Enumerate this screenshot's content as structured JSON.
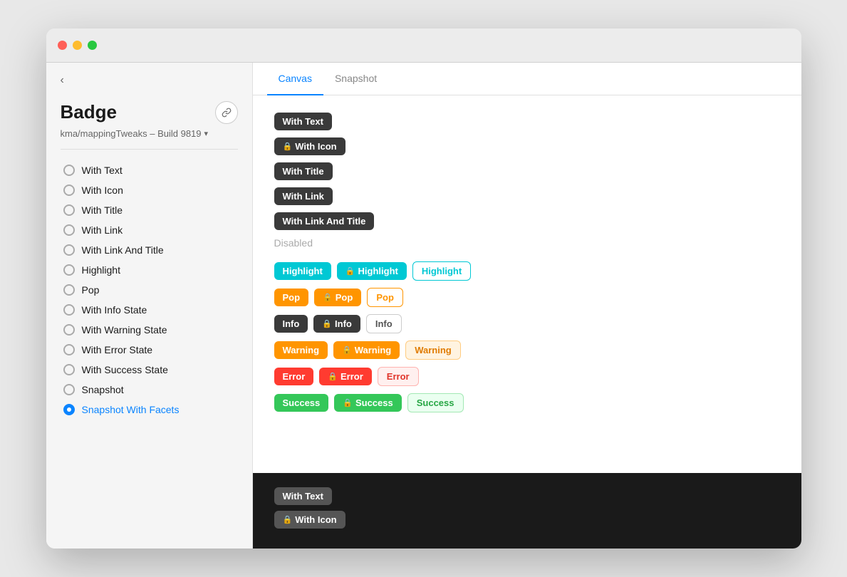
{
  "window": {
    "title": "Badge"
  },
  "titlebar": {
    "tl_red": "close",
    "tl_yellow": "minimize",
    "tl_green": "maximize"
  },
  "sidebar": {
    "back_label": "‹",
    "title": "Badge",
    "subtitle": "kma/mappingTweaks – Build 9819",
    "link_icon": "🔗",
    "nav_items": [
      {
        "id": "with-text",
        "label": "With Text",
        "active": false
      },
      {
        "id": "with-icon",
        "label": "With Icon",
        "active": false
      },
      {
        "id": "with-title",
        "label": "With Title",
        "active": false
      },
      {
        "id": "with-link",
        "label": "With Link",
        "active": false
      },
      {
        "id": "with-link-and-title",
        "label": "With Link And Title",
        "active": false
      },
      {
        "id": "highlight",
        "label": "Highlight",
        "active": false
      },
      {
        "id": "pop",
        "label": "Pop",
        "active": false
      },
      {
        "id": "with-info-state",
        "label": "With Info State",
        "active": false
      },
      {
        "id": "with-warning-state",
        "label": "With Warning State",
        "active": false
      },
      {
        "id": "with-error-state",
        "label": "With Error State",
        "active": false
      },
      {
        "id": "with-success-state",
        "label": "With Success State",
        "active": false
      },
      {
        "id": "snapshot",
        "label": "Snapshot",
        "active": false
      },
      {
        "id": "snapshot-with-facets",
        "label": "Snapshot With Facets",
        "active": true
      }
    ]
  },
  "tabs": [
    {
      "id": "canvas",
      "label": "Canvas",
      "active": true
    },
    {
      "id": "snapshot",
      "label": "Snapshot",
      "active": false
    }
  ],
  "canvas": {
    "section_disabled_label": "Disabled",
    "badges": {
      "with_text": "With Text",
      "with_icon": "With Icon",
      "with_title": "With Title",
      "with_link": "With Link",
      "with_link_and_title": "With Link And Title",
      "highlight1": "Highlight",
      "highlight2": "Highlight",
      "highlight3": "Highlight",
      "pop1": "Pop",
      "pop2": "Pop",
      "pop3": "Pop",
      "info1": "Info",
      "info2": "Info",
      "info3": "Info",
      "warning1": "Warning",
      "warning2": "Warning",
      "warning3": "Warning",
      "error1": "Error",
      "error2": "Error",
      "error3": "Error",
      "success1": "Success",
      "success2": "Success",
      "success3": "Success"
    }
  },
  "dark_section": {
    "with_text": "With Text",
    "with_icon": "With Icon"
  }
}
